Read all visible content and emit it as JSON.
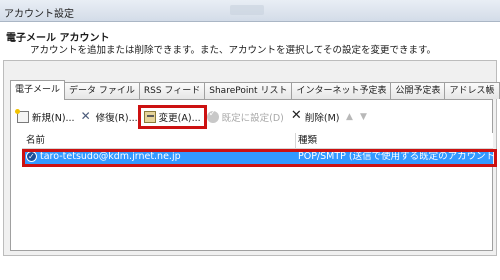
{
  "window": {
    "title": "アカウント設定"
  },
  "header": {
    "title": "電子メール アカウント",
    "description": "アカウントを追加または削除できます。また、アカウントを選択してその設定を変更できます。"
  },
  "tabs": [
    {
      "label": "電子メール",
      "active": true
    },
    {
      "label": "データ ファイル"
    },
    {
      "label": "RSS フィード"
    },
    {
      "label": "SharePoint リスト"
    },
    {
      "label": "インターネット予定表"
    },
    {
      "label": "公開予定表"
    },
    {
      "label": "アドレス帳"
    }
  ],
  "toolbar": {
    "new_label": "新規(N)...",
    "repair_label": "修復(R)...",
    "change_label": "変更(A)...",
    "default_label": "既定に設定(D)",
    "delete_label": "削除(M)"
  },
  "list": {
    "columns": [
      "名前",
      "種類"
    ],
    "rows": [
      {
        "name": "taro-tetsudo@kdm.jrnet.ne.jp",
        "type": "POP/SMTP (送信で使用する既定のアカウント)"
      }
    ]
  },
  "colors": {
    "selection": "#3399ff",
    "highlight_outline": "#cc1111"
  }
}
